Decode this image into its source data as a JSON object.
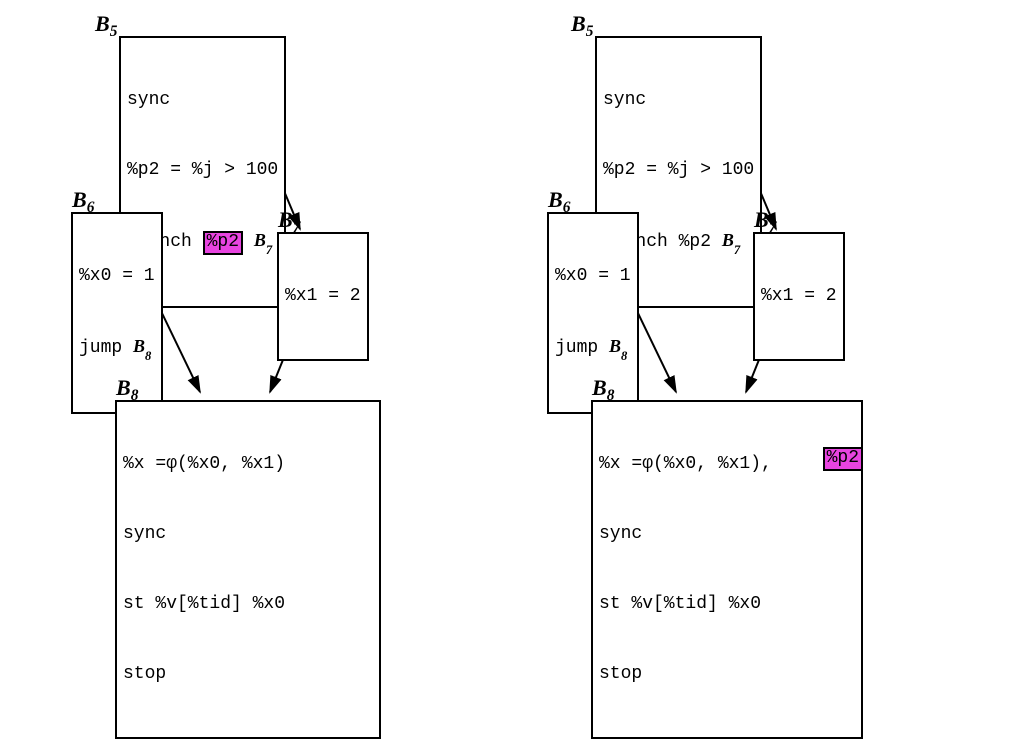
{
  "left": {
    "b5_label": "B",
    "b5_sub": "5",
    "b5_line1": "sync",
    "b5_line2": "%p2 = %j > 100",
    "b5_line3a": "branch ",
    "b5_line3b": "%p2",
    "b5_line3c": " ",
    "b5_line3d_main": "B",
    "b5_line3d_sub": "7",
    "b6_label": "B",
    "b6_sub": "6",
    "b6_line1": "%x0 = 1",
    "b6_line2a": "jump ",
    "b6_line2b_main": "B",
    "b6_line2b_sub": "8",
    "b7_label": "B",
    "b7_sub": "7",
    "b7_line1": "%x1 = 2",
    "b8_label": "B",
    "b8_sub": "8",
    "b8_line1": "%x =φ(%x0, %x1)",
    "b8_line2": "sync",
    "b8_line3": "st %v[%tid] %x0",
    "b8_line4": "stop"
  },
  "right": {
    "b5_label": "B",
    "b5_sub": "5",
    "b5_line1": "sync",
    "b5_line2": "%p2 = %j > 100",
    "b5_line3a": "branch %p2 ",
    "b5_line3b_main": "B",
    "b5_line3b_sub": "7",
    "b6_label": "B",
    "b6_sub": "6",
    "b6_line1": "%x0 = 1",
    "b6_line2a": "jump ",
    "b6_line2b_main": "B",
    "b6_line2b_sub": "8",
    "b7_label": "B",
    "b7_sub": "7",
    "b7_line1": "%x1 = 2",
    "b8_label": "B",
    "b8_sub": "8",
    "b8_line1a": "%x =φ(%x0, %x1), ",
    "b8_line1b": "%p2",
    "b8_line2": "sync",
    "b8_line3": "st %v[%tid] %x0",
    "b8_line4": "stop"
  },
  "highlight_color": "#e844e0"
}
